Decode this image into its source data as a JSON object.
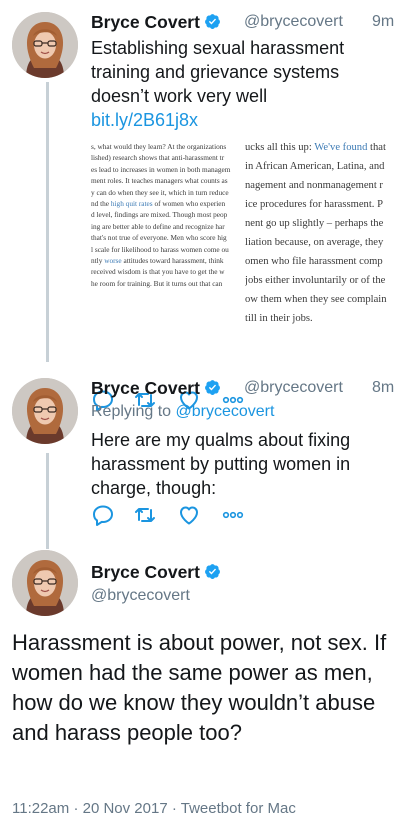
{
  "colors": {
    "text": "#14171a",
    "secondary": "#657786",
    "link": "#1b95e0",
    "verified": "#1da1f2",
    "thread_line": "#c7d0d6",
    "action_icon": "#aab8c2"
  },
  "tweets": [
    {
      "name": "Bryce Covert",
      "handle": "@brycecovert",
      "time": "9m",
      "text": "Establishing sexual harassment training and grievance systems doesn’t work very well",
      "link": "bit.ly/2B61j8x",
      "media": {
        "left_lines": [
          "s, what would they learn? At the organizations",
          "lished) research shows that anti-harassment tr",
          "es lead to increases in women in both managem",
          "ment roles. It teaches managers what counts as",
          "y can do when they see it, which in turn reduce",
          "nd the high quit rates of women who experien",
          "d level, findings are mixed. Though most peop",
          "ing are better able to define and recognize har",
          "that's not true of everyone. Men who score hig",
          "l scale for likelihood to harass women come ou",
          "ntly worse attitudes toward harassment, think",
          "received wisdom is that you have to get the w",
          "he room for training. But it turns out that can"
        ],
        "right_lines": [
          "ucks all this up: We've found that",
          "in African American, Latina, and",
          "nagement and nonmanagement r",
          "ice procedures for harassment. P",
          "nent go up slightly – perhaps the",
          "liation because, on average, they",
          "omen who file harassment comp",
          "jobs either involuntarily or of the",
          "ow them when they see complain",
          "till in their jobs."
        ]
      },
      "actions": [
        "reply-icon",
        "retweet-icon",
        "like-icon",
        "more-icon"
      ]
    },
    {
      "name": "Bryce Covert",
      "handle": "@brycecovert",
      "time": "8m",
      "replying_label": "Replying to",
      "replying_handle": "@brycecovert",
      "text": "Here are my qualms about fixing harassment by putting women in charge, though:",
      "actions": [
        "reply-icon",
        "retweet-icon",
        "like-icon",
        "more-icon"
      ]
    }
  ],
  "main_tweet": {
    "name": "Bryce Covert",
    "handle": "@brycecovert",
    "text": "Harassment is about power, not sex. If women had the same power as men, how do we know they wouldn’t abuse and harass people too?",
    "time": "11:22am",
    "separator": "·",
    "date": "20 Nov 2017",
    "client": "Tweetbot for Mac"
  }
}
